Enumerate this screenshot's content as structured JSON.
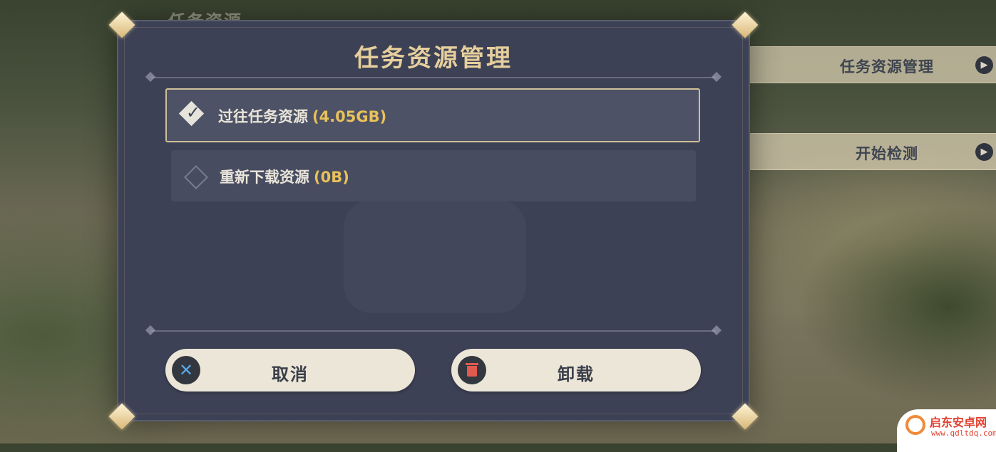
{
  "background": {
    "heading": "任务资源",
    "side_buttons": [
      {
        "label": "任务资源管理"
      },
      {
        "label": "开始检测"
      }
    ]
  },
  "dialog": {
    "title": "任务资源管理",
    "options": [
      {
        "label": "过往任务资源",
        "size": "(4.05GB)",
        "checked": true
      },
      {
        "label": "重新下载资源",
        "size": "(0B)",
        "checked": false
      }
    ],
    "cancel_label": "取消",
    "uninstall_label": "卸载"
  },
  "watermark": {
    "name": "启东安卓网",
    "url": "www.qdltdq.com"
  },
  "colors": {
    "dialog_bg": "#3d4155",
    "title": "#e6cf9c",
    "size_highlight": "#e8c15a",
    "button_bg": "#ece6d8",
    "cancel_icon": "#58a8e8",
    "trash_icon": "#e05a4e"
  }
}
